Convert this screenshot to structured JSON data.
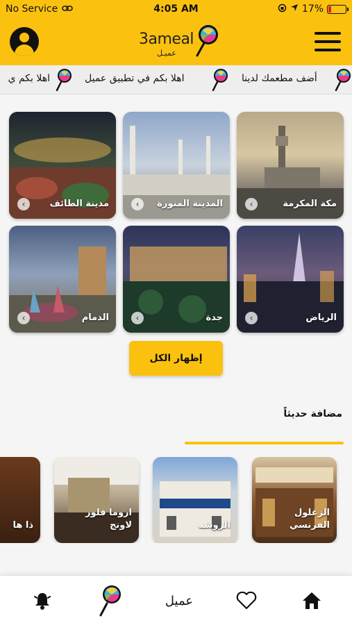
{
  "status_bar": {
    "carrier": "No Service",
    "time": "4:05 AM",
    "battery": "17%",
    "battery_level": 0.17
  },
  "header": {
    "logo_latin": "3ameal",
    "logo_arabic": "عميـل"
  },
  "marquee": {
    "items": [
      "أضف مطعمك لدينا",
      "اهلا بكم في تطبيق عميل",
      "اهلا بكم ي"
    ]
  },
  "cities": [
    {
      "label": "مكة المكرمة"
    },
    {
      "label": "المدينة المنورة"
    },
    {
      "label": "مدينة الطائف"
    },
    {
      "label": "الرياض"
    },
    {
      "label": "جدة"
    },
    {
      "label": "الدمام"
    }
  ],
  "show_all_label": "إظهار الكل",
  "recent_section": {
    "title": "مضافة حديثاً",
    "items": [
      {
        "label": "الزغلول الفرنسي"
      },
      {
        "label": "الروشه"
      },
      {
        "label": "اروما فلور لاونج"
      },
      {
        "label": "ذا ها"
      }
    ]
  },
  "bottom_nav": {
    "center_label": "عميل"
  },
  "colors": {
    "brand_yellow": "#fbc10f"
  }
}
